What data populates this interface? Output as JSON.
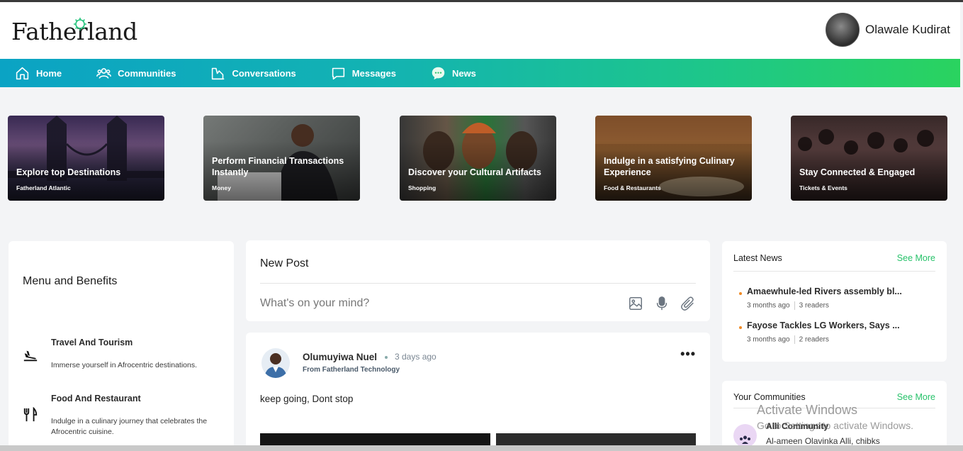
{
  "app": {
    "logo": "Fatherland"
  },
  "user": {
    "name": "Olawale Kudirat"
  },
  "nav": [
    {
      "label": "Home",
      "icon": "home-icon"
    },
    {
      "label": "Communities",
      "icon": "users-icon"
    },
    {
      "label": "Conversations",
      "icon": "conversations-icon"
    },
    {
      "label": "Messages",
      "icon": "message-icon"
    },
    {
      "label": "News",
      "icon": "news-chat-icon"
    }
  ],
  "cards": [
    {
      "title": "Explore top Destinations",
      "sub": "Fatherland Atlantic"
    },
    {
      "title": "Perform Financial Transactions Instantly",
      "sub": "Money"
    },
    {
      "title": "Discover your Cultural Artifacts",
      "sub": "Shopping"
    },
    {
      "title": "Indulge in a satisfying Culinary Experience",
      "sub": "Food & Restaurants"
    },
    {
      "title": "Stay Connected & Engaged",
      "sub": "Tickets & Events"
    }
  ],
  "menu": {
    "title": "Menu and Benefits",
    "items": [
      {
        "title": "Travel And Tourism",
        "desc": "Immerse yourself in Afrocentric destinations.",
        "icon": "plane-landing-icon"
      },
      {
        "title": "Food And Restaurant",
        "desc": "Indulge in a culinary journey that celebrates the Afrocentric cuisine.",
        "icon": "fork-knife-icon"
      }
    ]
  },
  "new_post": {
    "title": "New Post",
    "placeholder": "What's on your mind?",
    "icons": [
      "image-icon",
      "microphone-icon",
      "paperclip-icon"
    ]
  },
  "post": {
    "author": "Olumuyiwa Nuel",
    "time": "3 days ago",
    "from": "From Fatherland Technology",
    "text": "keep going, Dont stop",
    "more": "•••"
  },
  "latest_news": {
    "title": "Latest News",
    "see_more": "See More",
    "items": [
      {
        "title": "Amaewhule-led Rivers assembly bl...",
        "date": "3 months ago",
        "readers": "3 readers"
      },
      {
        "title": "Fayose Tackles LG Workers, Says ...",
        "date": "3 months ago",
        "readers": "2 readers"
      }
    ]
  },
  "communities": {
    "title": "Your Communities",
    "see_more": "See More",
    "items": [
      {
        "name": "Alli Community",
        "members": "Al-ameen Olavinka Alli, chibks"
      }
    ]
  },
  "watermark": {
    "title": "Activate Windows",
    "sub": "Go to Settings to activate Windows."
  },
  "colors": {
    "accent_green": "#27c26a",
    "nav_start": "#0ba3c4",
    "nav_end": "#2ad35f",
    "news_bullet": "#f08a24"
  }
}
